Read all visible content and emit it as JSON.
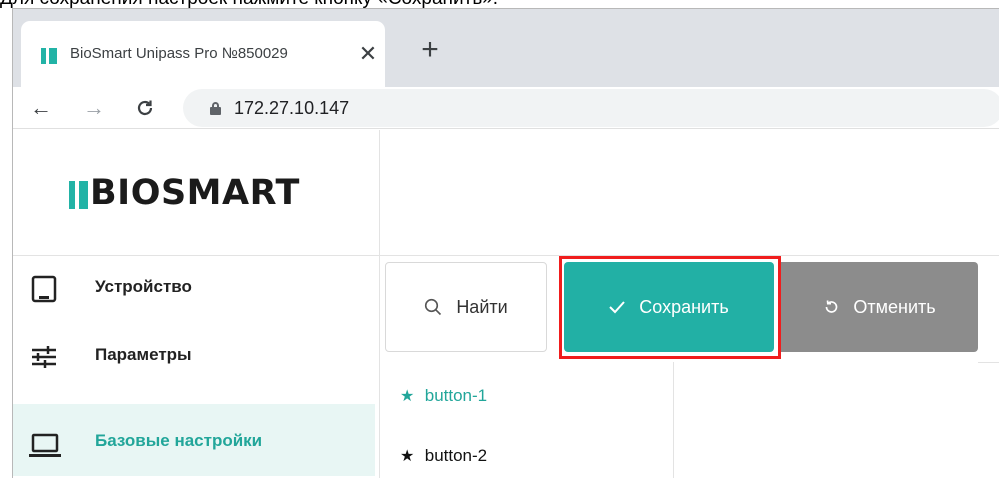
{
  "caption": "Для сохранения настроек нажмите кнопку «Сохранить».",
  "browser": {
    "tab_title": "BioSmart Unipass Pro №850029",
    "tab_close": "✕",
    "new_tab": "+",
    "back": "←",
    "forward": "→",
    "reload": "C",
    "url": "172.27.10.147"
  },
  "app": {
    "logo_text": "BIOSMART",
    "sidebar": {
      "items": [
        {
          "label": "Устройство",
          "icon": "tablet-icon"
        },
        {
          "label": "Параметры",
          "icon": "sliders-icon"
        },
        {
          "label": "Базовые настройки",
          "icon": "laptop-icon",
          "active": true
        }
      ]
    },
    "toolbar": {
      "search_label": "Найти",
      "save_label": "Сохранить",
      "cancel_label": "Отменить"
    },
    "tree": {
      "items": [
        {
          "label": "button-1",
          "selected": true
        },
        {
          "label": "button-2",
          "selected": false
        }
      ]
    },
    "colors": {
      "accent": "#22b0a5",
      "cancel": "#8c8c8c",
      "active_bg": "#e8f6f4",
      "highlight": "#f01d1d"
    }
  }
}
